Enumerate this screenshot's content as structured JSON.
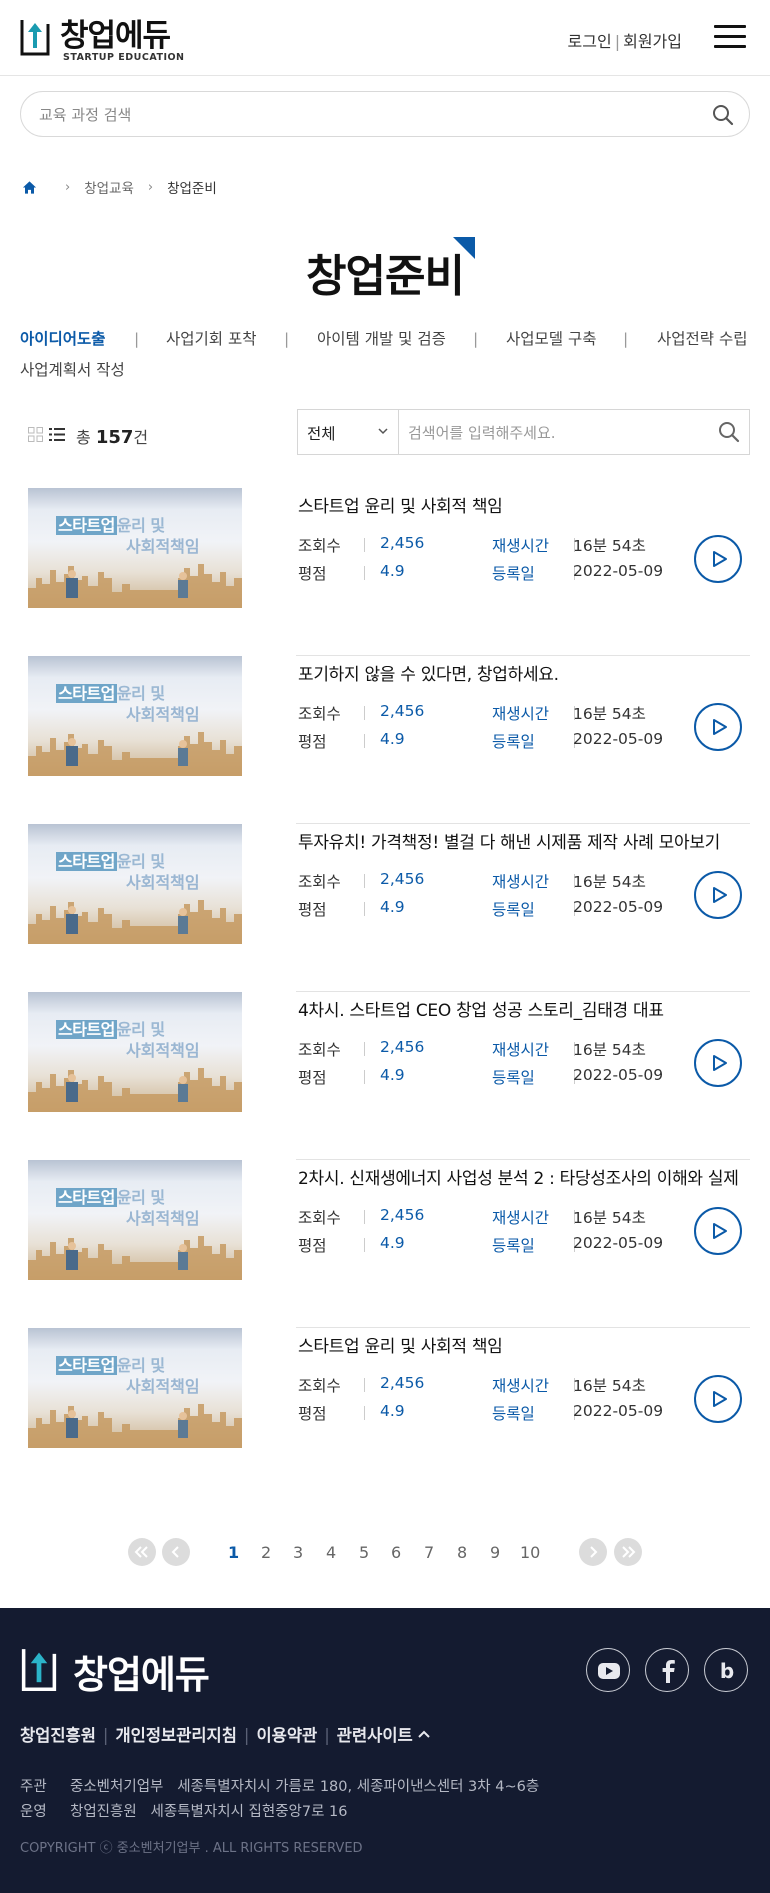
{
  "header": {
    "logo_text": "창업에듀",
    "logo_sub": "STARTUP EDUCATION",
    "login": "로그인",
    "signup": "회원가입"
  },
  "search": {
    "placeholder": "교육 과정 검색"
  },
  "breadcrumb": [
    "창업교육",
    "창업준비"
  ],
  "page_title": "창업준비",
  "categories": [
    {
      "label": "아이디어도출",
      "active": true
    },
    {
      "label": "사업기회 포착"
    },
    {
      "label": "아이템 개발 및 검증"
    },
    {
      "label": "사업모델 구축"
    },
    {
      "label": "사업전략 수립"
    },
    {
      "label": "사업계획서 작성"
    }
  ],
  "list_toolbar": {
    "total_prefix": "총",
    "total_count": "157",
    "total_suffix": "건",
    "filter_selected": "전체",
    "filter_placeholder": "검색어를 입력해주세요."
  },
  "meta_labels": {
    "views": "조회수",
    "rating": "평점",
    "duration": "재생시간",
    "date": "등록일"
  },
  "thumb_text": {
    "line1a": "스타트업",
    "line1b": "윤리 및",
    "line2": "사회적책임"
  },
  "courses": [
    {
      "title": "스타트업 윤리 및 사회적 책임",
      "views": "2,456",
      "rating": "4.9",
      "duration": "16분 54초",
      "date": "2022-05-09"
    },
    {
      "title": "포기하지 않을 수 있다면, 창업하세요.",
      "views": "2,456",
      "rating": "4.9",
      "duration": "16분 54초",
      "date": "2022-05-09"
    },
    {
      "title": "투자유치! 가격책정! 별걸 다 해낸 시제품 제작 사례 모아보기",
      "views": "2,456",
      "rating": "4.9",
      "duration": "16분 54초",
      "date": "2022-05-09"
    },
    {
      "title": "4차시. 스타트업 CEO 창업 성공 스토리_김태경 대표",
      "views": "2,456",
      "rating": "4.9",
      "duration": "16분 54초",
      "date": "2022-05-09"
    },
    {
      "title": "2차시. 신재생에너지 사업성 분석 2 : 타당성조사의 이해와 실제",
      "views": "2,456",
      "rating": "4.9",
      "duration": "16분 54초",
      "date": "2022-05-09"
    },
    {
      "title": "스타트업 윤리 및 사회적 책임",
      "views": "2,456",
      "rating": "4.9",
      "duration": "16분 54초",
      "date": "2022-05-09"
    }
  ],
  "pagination": {
    "pages": [
      "1",
      "2",
      "3",
      "4",
      "5",
      "6",
      "7",
      "8",
      "9",
      "10"
    ],
    "current": "1"
  },
  "footer": {
    "logo_text": "창업에듀",
    "links": [
      "창업진흥원",
      "개인정보관리지침",
      "이용약관",
      "관련사이트"
    ],
    "host_label": "주관",
    "host_name": "중소벤처기업부",
    "host_addr": "세종특별자치시 가름로 180, 세종파이낸스센터 3차 4~6층",
    "op_label": "운영",
    "op_name": "창업진흥원",
    "op_addr": "세종특별자치시 집현중앙7로 16",
    "copyright": "COPYRIGHT ⓒ 중소벤처기업부 . ALL RIGHTS RESERVED",
    "social": [
      "youtube-icon",
      "facebook-icon",
      "blog-icon"
    ]
  },
  "colors": {
    "accent": "#0b5aa8",
    "footer_bg": "#141b30",
    "logo_teal": "#1a9bb0"
  }
}
